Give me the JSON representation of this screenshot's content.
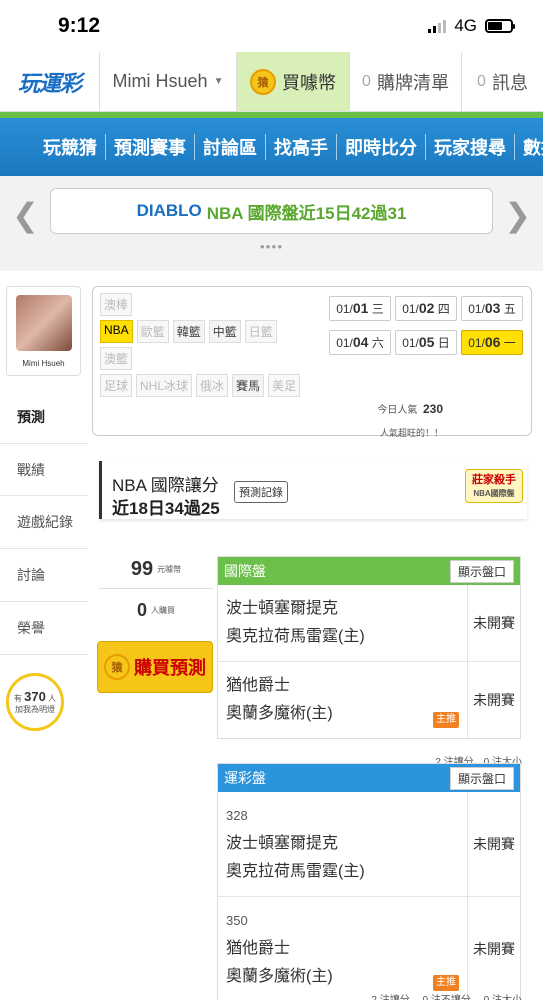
{
  "status_bar": {
    "time": "9:12",
    "network": "4G"
  },
  "top_nav": {
    "logo": "玩運彩",
    "user": "Mimi Hsueh",
    "buy_coin_icon_text": "猿",
    "buy_coin": "買噱幣",
    "cart_count": "0",
    "cart": "購牌清單",
    "msg_count": "0",
    "msg": "訊息"
  },
  "main_nav": [
    "玩競猜",
    "預測賽事",
    "討論區",
    "找高手",
    "即時比分",
    "玩家搜尋",
    "數據"
  ],
  "banner": {
    "part1": "DIABLO",
    "part2": "NBA 國際盤近15日42過31"
  },
  "sidebar": {
    "avatar_name": "Mimi Hsueh",
    "tabs": [
      "預測",
      "戰績",
      "遊戲紀錄",
      "討論",
      "榮譽"
    ],
    "fans_prefix": "有",
    "fans_count": "370",
    "fans_unit": "人",
    "fans_note": "加我為明燈"
  },
  "filters": {
    "row1": [
      "澳棒"
    ],
    "row2": [
      "NBA",
      "歐籃",
      "韓籃",
      "中籃",
      "日籃"
    ],
    "row3": [
      "澳籃"
    ],
    "row4": [
      "足球",
      "NHL冰球",
      "俄冰",
      "賽馬",
      "美足"
    ]
  },
  "dates": [
    {
      "md": "01/",
      "d": "01",
      "w": "三"
    },
    {
      "md": "01/",
      "d": "02",
      "w": "四"
    },
    {
      "md": "01/",
      "d": "03",
      "w": "五"
    },
    {
      "md": "01/",
      "d": "04",
      "w": "六"
    },
    {
      "md": "01/",
      "d": "05",
      "w": "日"
    },
    {
      "md": "01/",
      "d": "06",
      "w": "一"
    }
  ],
  "popularity": {
    "label": "今日人氣",
    "value": "230",
    "note": "人氣超旺的！！"
  },
  "predictor": {
    "title": "NBA 國際讓分",
    "record": "近18日34過25",
    "record_button": "預測記錄",
    "badge_title": "莊家殺手",
    "badge_sub": "NBA國際盤"
  },
  "price": {
    "value": "99",
    "unit": "元噱幣",
    "buyers": "0",
    "buyers_unit": "人購買",
    "buy_button": "購買預測"
  },
  "market1": {
    "title": "國際盤",
    "show": "顯示盤口",
    "games": [
      {
        "away": "波士頓塞爾提克",
        "home": "奧克拉荷馬雷霆(主)",
        "status": "未開賽",
        "tag": ""
      },
      {
        "away": "猶他爵士",
        "home": "奧蘭多魔術(主)",
        "status": "未開賽",
        "tag": "主推"
      }
    ],
    "summary": "2 注讓分、0 注大小"
  },
  "market2": {
    "title": "運彩盤",
    "show": "顯示盤口",
    "games": [
      {
        "num": "328",
        "away": "波士頓塞爾提克",
        "home": "奧克拉荷馬雷霆(主)",
        "status": "未開賽",
        "tag": ""
      },
      {
        "num": "350",
        "away": "猶他爵士",
        "home": "奧蘭多魔術(主)",
        "status": "未開賽",
        "tag": "主推"
      }
    ],
    "summary": "2 注讓分、 0 注不讓分、 0 注大小"
  }
}
